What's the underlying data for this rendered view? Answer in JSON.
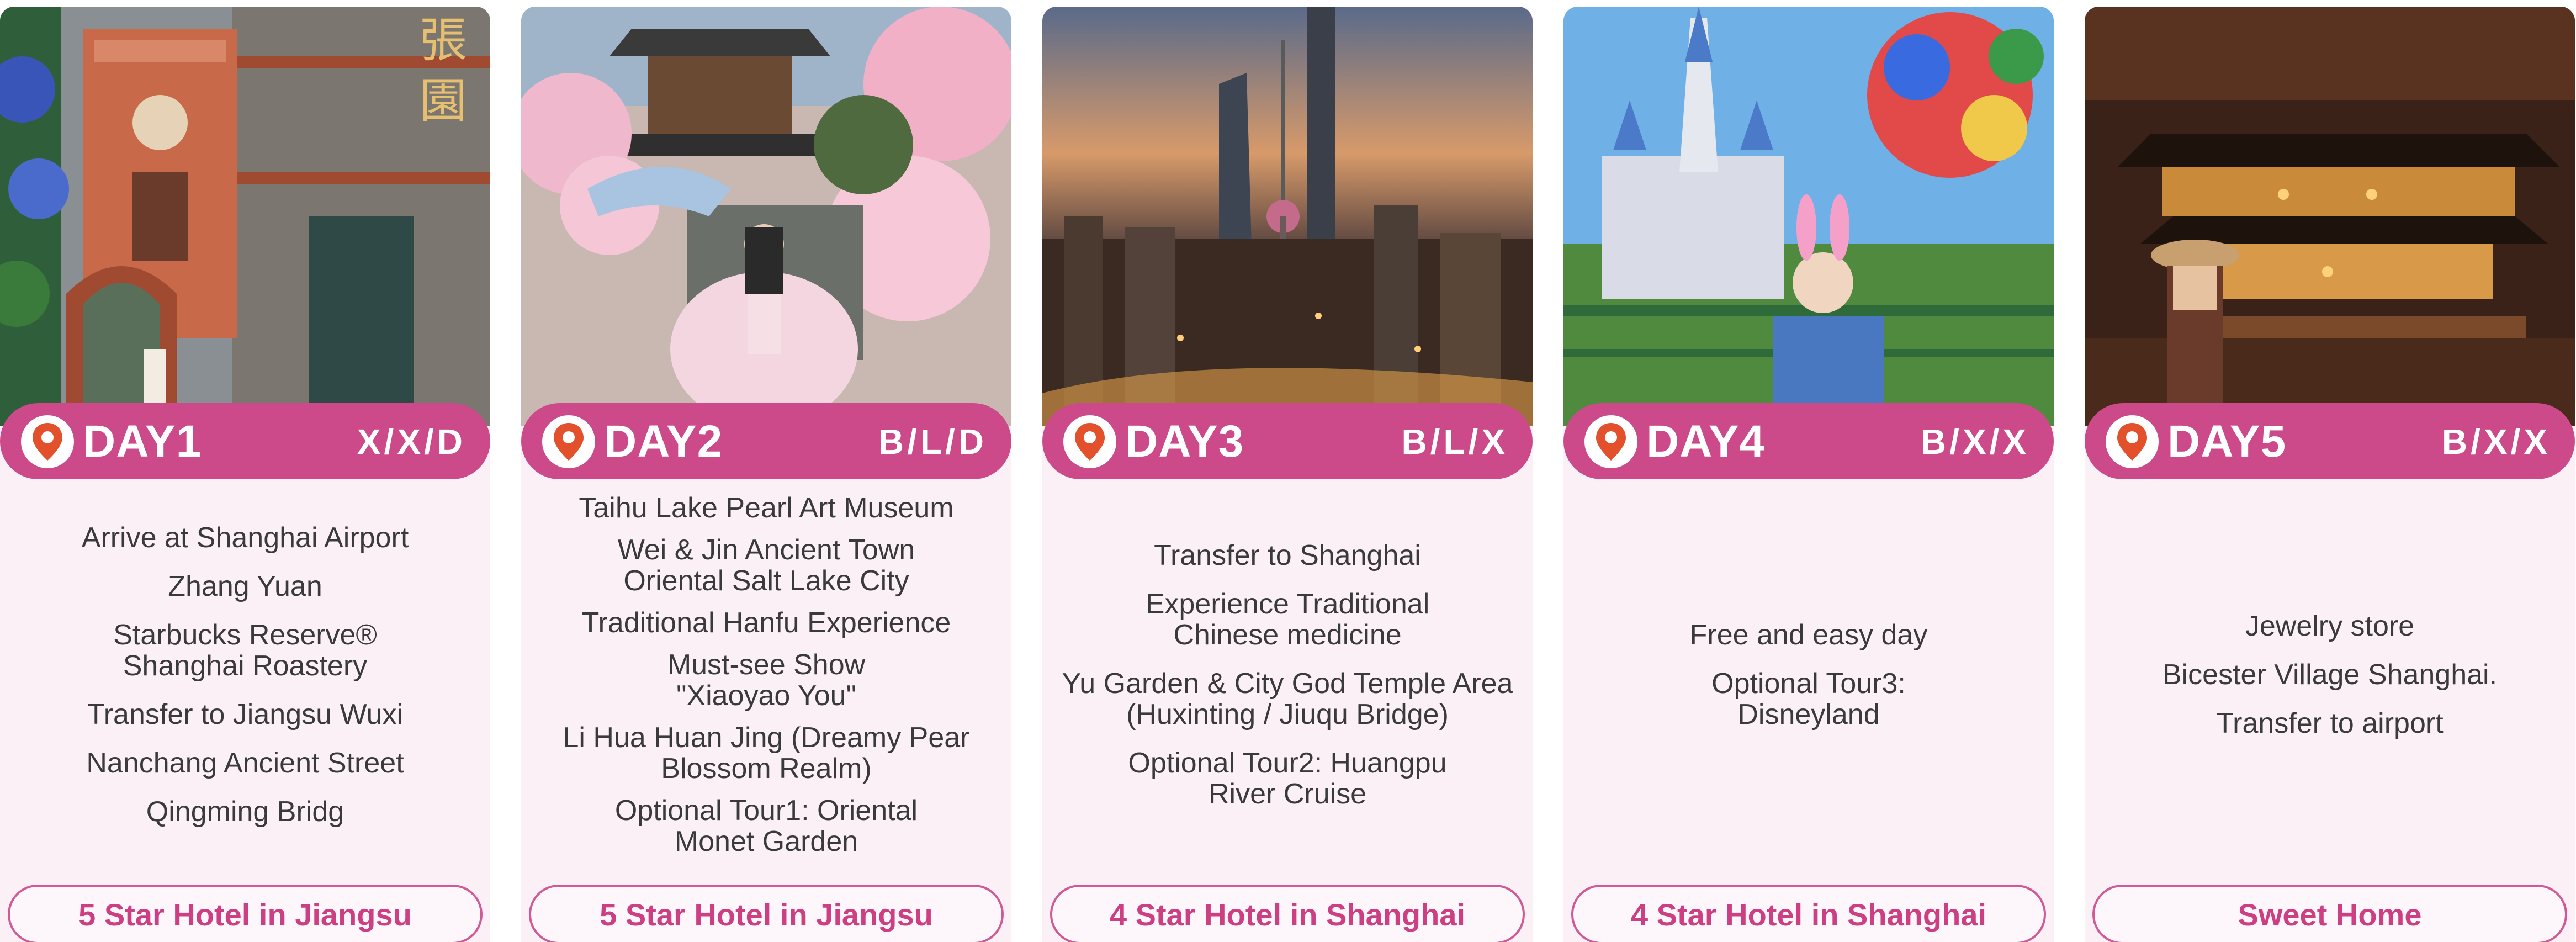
{
  "days": [
    {
      "label": "DAY1",
      "meals": "X/X/D",
      "photo": "shanghai-brick-building-photo",
      "stops": [
        "Arrive at Shanghai Airport",
        "Zhang Yuan",
        "Starbucks Reserve® Shanghai Roastery",
        "Transfer to Jiangsu Wuxi",
        "Nanchang Ancient Street",
        "Qingming Bridg"
      ],
      "hotel": "5 Star Hotel in Jiangsu"
    },
    {
      "label": "DAY2",
      "meals": "B/L/D",
      "photo": "hanfu-pagoda-blossom-photo",
      "stops": [
        "Taihu Lake Pearl Art Museum",
        "Wei & Jin Ancient Town Oriental Salt Lake City",
        "Traditional Hanfu Experience",
        "Must-see Show \"Xiaoyao You\"",
        "Li Hua Huan Jing (Dreamy Pear Blossom Realm)",
        "Optional Tour1: Oriental Monet Garden"
      ],
      "hotel": "5 Star Hotel in Jiangsu"
    },
    {
      "label": "DAY3",
      "meals": "B/L/X",
      "photo": "shanghai-skyline-dusk-photo",
      "stops": [
        "Transfer to Shanghai",
        "Experience Traditional Chinese medicine",
        "Yu Garden & City God Temple Area (Huxinting / Jiuqu Bridge)",
        "Optional Tour2: Huangpu River Cruise"
      ],
      "hotel": "4 Star Hotel in Shanghai"
    },
    {
      "label": "DAY4",
      "meals": "B/X/X",
      "photo": "disneyland-castle-photo",
      "stops": [
        "Free and easy day",
        "Optional Tour3: Disneyland"
      ],
      "hotel": "4 Star Hotel in Shanghai"
    },
    {
      "label": "DAY5",
      "meals": "B/X/X",
      "photo": "yu-garden-night-photo",
      "stops": [
        "Jewelry store",
        "Bicester Village Shanghai.",
        "Transfer to airport"
      ],
      "hotel": "Sweet Home"
    }
  ],
  "colors": {
    "accent": "#cc4a8a",
    "card_bg": "#fbf0f6",
    "hotel_text": "#cc3f83",
    "pin": "#e2502c"
  },
  "icons": {
    "location": "location-pin-icon"
  }
}
